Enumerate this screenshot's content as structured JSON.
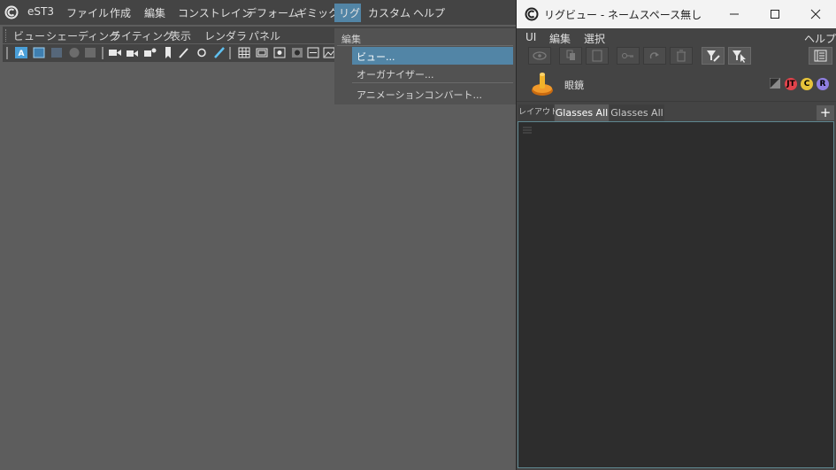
{
  "main_menu": {
    "app_name": "eST3",
    "items": [
      "ファイル",
      "作成",
      "編集",
      "コンストレイン",
      "デフォーム",
      "ギミック",
      "リグ",
      "カスタム",
      "ヘルプ"
    ]
  },
  "panel_menu": {
    "items": [
      "ビュー",
      "シェーディング",
      "ライティング",
      "表示",
      "レンダラ",
      "パネル"
    ]
  },
  "rig_dropdown": {
    "section_header": "編集",
    "items": [
      "ビュー...",
      "オーガナイザー...",
      "アニメーションコンバート..."
    ],
    "selected_index": 0
  },
  "rig_window": {
    "title": "リグビュー - ネームスペース無し",
    "menu_left": [
      "UI",
      "編集",
      "選択"
    ],
    "menu_right": "ヘルプ",
    "character_name": "眼鏡",
    "badges": [
      {
        "label": "JT",
        "color": "#e0434b"
      },
      {
        "label": "C",
        "color": "#e6c33a"
      },
      {
        "label": "R",
        "color": "#8f7fe0"
      }
    ],
    "tabs": [
      {
        "label": "レイアウト",
        "active": false
      },
      {
        "label": "Glasses All",
        "active": true
      },
      {
        "label": "Glasses All",
        "active": false
      }
    ],
    "add_tab_label": "+"
  },
  "colors": {
    "accent": "#5285a6",
    "canvas_border": "#5f8790"
  }
}
